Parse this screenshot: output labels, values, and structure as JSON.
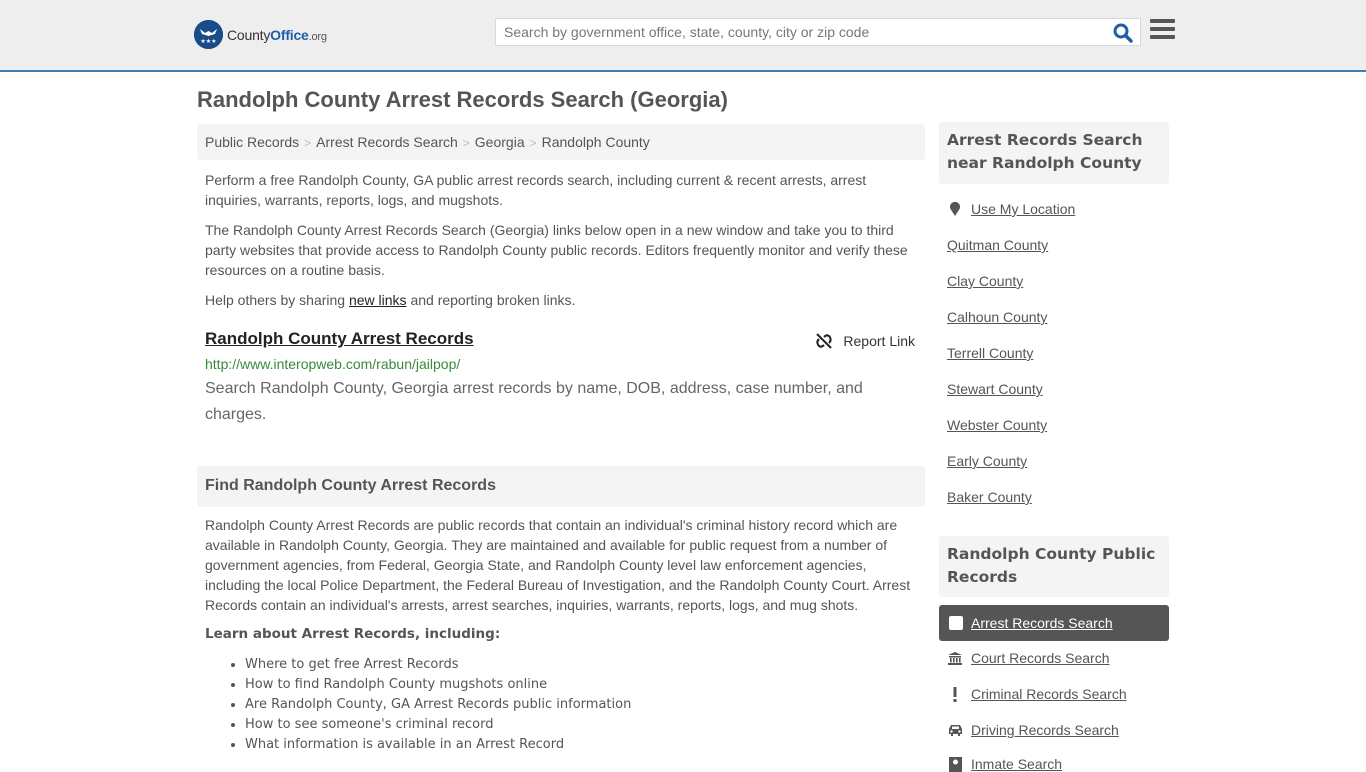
{
  "header": {
    "logo": {
      "name_part1": "County",
      "name_part2": "Office",
      "name_part3": ".org"
    },
    "search_placeholder": "Search by government office, state, county, city or zip code",
    "search_value": ""
  },
  "page_title": "Randolph County Arrest Records Search (Georgia)",
  "breadcrumb": [
    "Public Records",
    "Arrest Records Search",
    "Georgia",
    "Randolph County"
  ],
  "intro": {
    "p1": "Perform a free Randolph County, GA public arrest records search, including current & recent arrests, arrest inquiries, warrants, reports, logs, and mugshots.",
    "p2": "The Randolph County Arrest Records Search (Georgia) links below open in a new window and take you to third party websites that provide access to Randolph County public records. Editors frequently monitor and verify these resources on a routine basis.",
    "p3_before": "Help others by sharing ",
    "p3_link": "new links",
    "p3_after": " and reporting broken links."
  },
  "link_item": {
    "title": "Randolph County Arrest Records",
    "report_label": "Report Link",
    "url": "http://www.interopweb.com/rabun/jailpop/",
    "description": "Search Randolph County, Georgia arrest records by name, DOB, address, case number, and charges."
  },
  "find_section": {
    "heading": "Find Randolph County Arrest Records",
    "body": "Randolph County Arrest Records are public records that contain an individual's criminal history record which are available in Randolph County, Georgia. They are maintained and available for public request from a number of government agencies, from Federal, Georgia State, and Randolph County level law enforcement agencies, including the local Police Department, the Federal Bureau of Investigation, and the Randolph County Court. Arrest Records contain an individual's arrests, arrest searches, inquiries, warrants, reports, logs, and mug shots.",
    "learn_heading": "Learn about Arrest Records, including:",
    "learn_items": [
      "Where to get free Arrest Records",
      "How to find Randolph County mugshots online",
      "Are Randolph County, GA Arrest Records public information",
      "How to see someone's criminal record",
      "What information is available in an Arrest Record"
    ]
  },
  "sidebar": {
    "near_heading": "Arrest Records Search near Randolph County",
    "use_location": "Use My Location",
    "nearby": [
      "Quitman County",
      "Clay County",
      "Calhoun County",
      "Terrell County",
      "Stewart County",
      "Webster County",
      "Early County",
      "Baker County"
    ],
    "public_heading": "Randolph County Public Records",
    "public_items": [
      {
        "label": "Arrest Records Search",
        "icon": "square-icon",
        "active": true
      },
      {
        "label": "Court Records Search",
        "icon": "courthouse-icon"
      },
      {
        "label": "Criminal Records Search",
        "icon": "exclamation-icon"
      },
      {
        "label": "Driving Records Search",
        "icon": "car-icon"
      },
      {
        "label": "Inmate Search",
        "icon": "inmate-icon"
      }
    ]
  },
  "colors": {
    "accent_border": "#3f7cb0",
    "logo_blue": "#1f5fa8",
    "url_green": "#3a8a3a",
    "active_bg": "#555555"
  }
}
